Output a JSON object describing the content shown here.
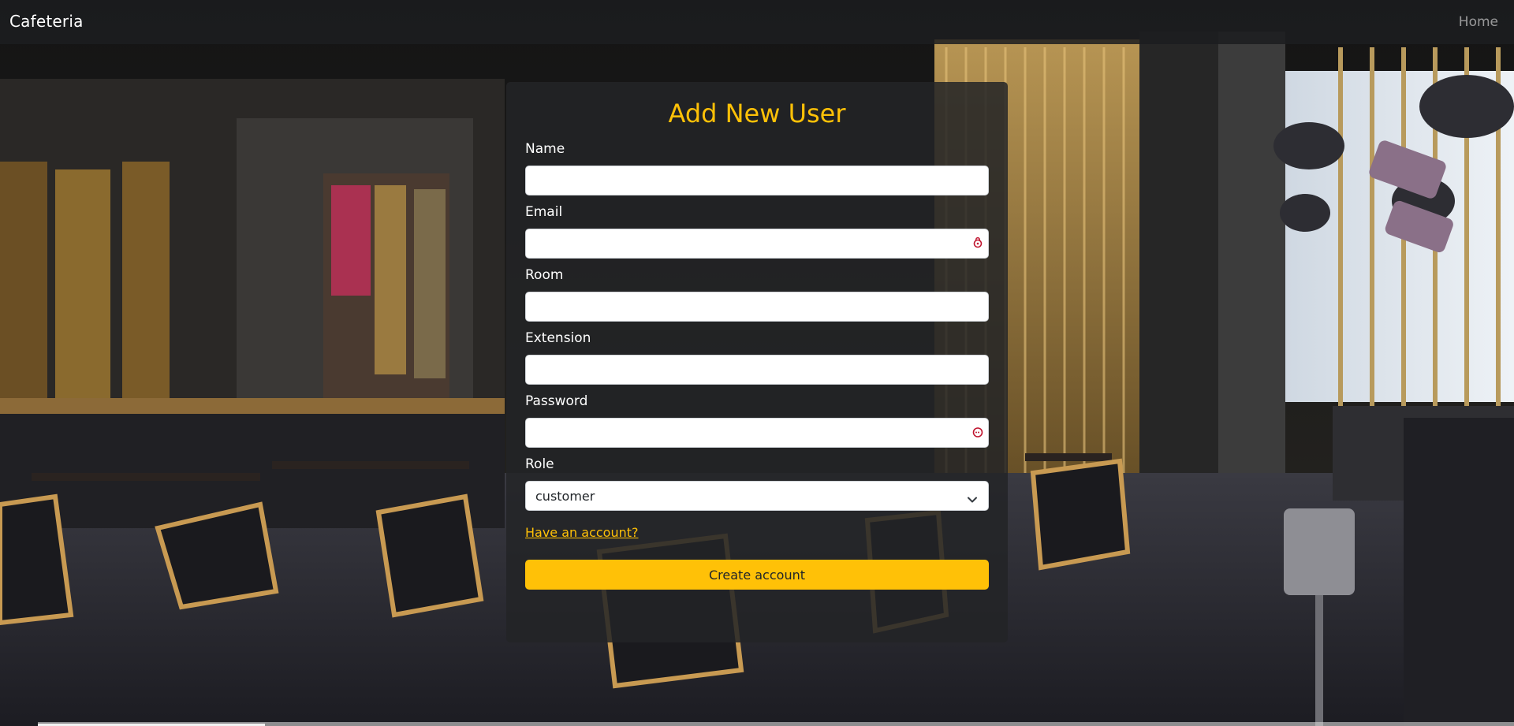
{
  "navbar": {
    "brand": "Cafeteria",
    "home_label": "Home"
  },
  "form": {
    "title": "Add New User",
    "title_color": "#ffc107",
    "fields": {
      "name": {
        "label": "Name",
        "value": ""
      },
      "email": {
        "label": "Email",
        "value": "",
        "icon": "password-manager-icon"
      },
      "room": {
        "label": "Room",
        "value": ""
      },
      "extension": {
        "label": "Extension",
        "value": ""
      },
      "password": {
        "label": "Password",
        "value": "",
        "icon": "password-manager-icon"
      },
      "role": {
        "label": "Role",
        "selected": "customer"
      }
    },
    "account_link": "Have an account?",
    "submit_label": "Create account",
    "accent_color": "#ffc107"
  }
}
